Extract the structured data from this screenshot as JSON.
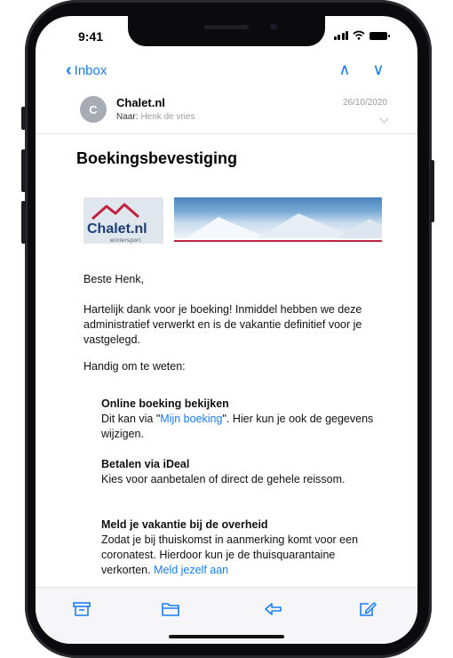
{
  "status": {
    "time": "9:41"
  },
  "nav": {
    "back_label": "Inbox",
    "up": "∧",
    "down": "∨"
  },
  "message": {
    "avatar_initial": "C",
    "sender": "Chalet.nl",
    "to_label": "Naar:",
    "to_name": "Henk de vries",
    "date": "26/10/2020",
    "subject": "Boekingsbevestiging"
  },
  "banner": {
    "logo": "Chalet.nl",
    "logo_sub": "wintersport"
  },
  "body": {
    "greeting": "Beste Henk,",
    "intro": "Hartelijk dank voor je boeking! Inmiddel hebben we deze administratief verwerkt en is de vakantie definitief voor je vastgelegd.",
    "handy": "Handig om te weten:",
    "sections": [
      {
        "title": "Online boeking bekijken",
        "text_before": "Dit kan via \"",
        "link": "Mijn boeking",
        "text_after": "\". Hier kun je ook de gegevens wijzigen."
      },
      {
        "title": "Betalen via iDeal",
        "text": "Kies voor aanbetalen of direct de gehele reissom."
      },
      {
        "title": "Meld je vakantie bij de overheid",
        "text": "Zodat je bij thuiskomst in aanmerking komt voor een coronatest. Hierdoor kun je de thuisquarantaine verkorten. ",
        "link": "Meld jezelf aan"
      }
    ]
  },
  "toolbar": {
    "icons": [
      "archive-icon",
      "folder-icon",
      "reply-icon",
      "compose-icon"
    ]
  },
  "colors": {
    "accent": "#1a7cf5",
    "brand_red": "#c0233f",
    "brand_blue": "#1d3e73"
  }
}
